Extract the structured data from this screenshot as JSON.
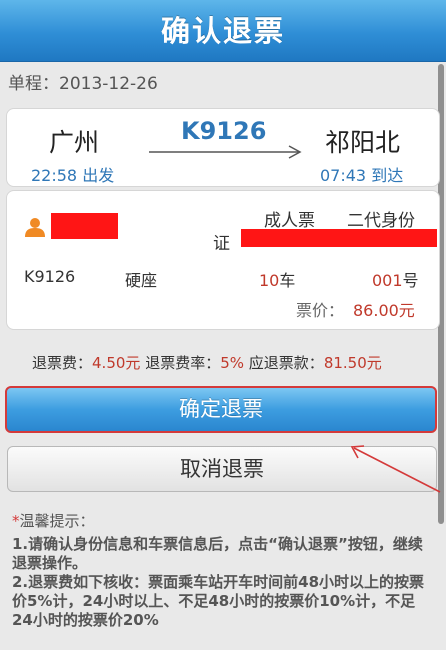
{
  "header": {
    "title": "确认退票"
  },
  "trip": {
    "label": "单程：",
    "date": "2013-12-26"
  },
  "route": {
    "from": "广州",
    "to": "祁阳北",
    "train": "K9126",
    "departure_time": "22:58",
    "departure_label": "出发",
    "arrival_time": "07:43",
    "arrival_label": "到达"
  },
  "ticket": {
    "passenger_type": "成人票",
    "id_type_line1": "二代身份",
    "id_type_line2": "证",
    "train": "K9126",
    "seat_type": "硬座",
    "car_number": "10",
    "car_unit": "车",
    "seat_number": "001",
    "seat_unit": "号",
    "price_label": "票价：",
    "price": "86.00元"
  },
  "fees": {
    "fee_label": "退票费：",
    "fee": "4.50元",
    "rate_label": "退票费率：",
    "rate": "5%",
    "refund_label": "应退票款：",
    "refund": "81.50元"
  },
  "buttons": {
    "confirm": "确定退票",
    "cancel": "取消退票"
  },
  "tips": {
    "star": "*",
    "title": "温馨提示：",
    "items": [
      "1.请确认身份信息和车票信息后，点击“确认退票”按钮，继续退票操作。",
      "2.退票费如下核收：票面乘车站开车时间前48小时以上的按票价5%计，24小时以上、不足48小时的按票价10%计，不足24小时的按票价20%"
    ]
  },
  "colors": {
    "header_blue": "#2f8ed6",
    "accent_blue": "#2f77b7",
    "price_red": "#c0392b",
    "redaction": "#ff1515",
    "annotation": "#d43a3a"
  },
  "icons": {
    "person": "person-icon",
    "route_arrow": "arrow-right-icon",
    "annotation_arrow": "annotation-arrow-icon"
  }
}
